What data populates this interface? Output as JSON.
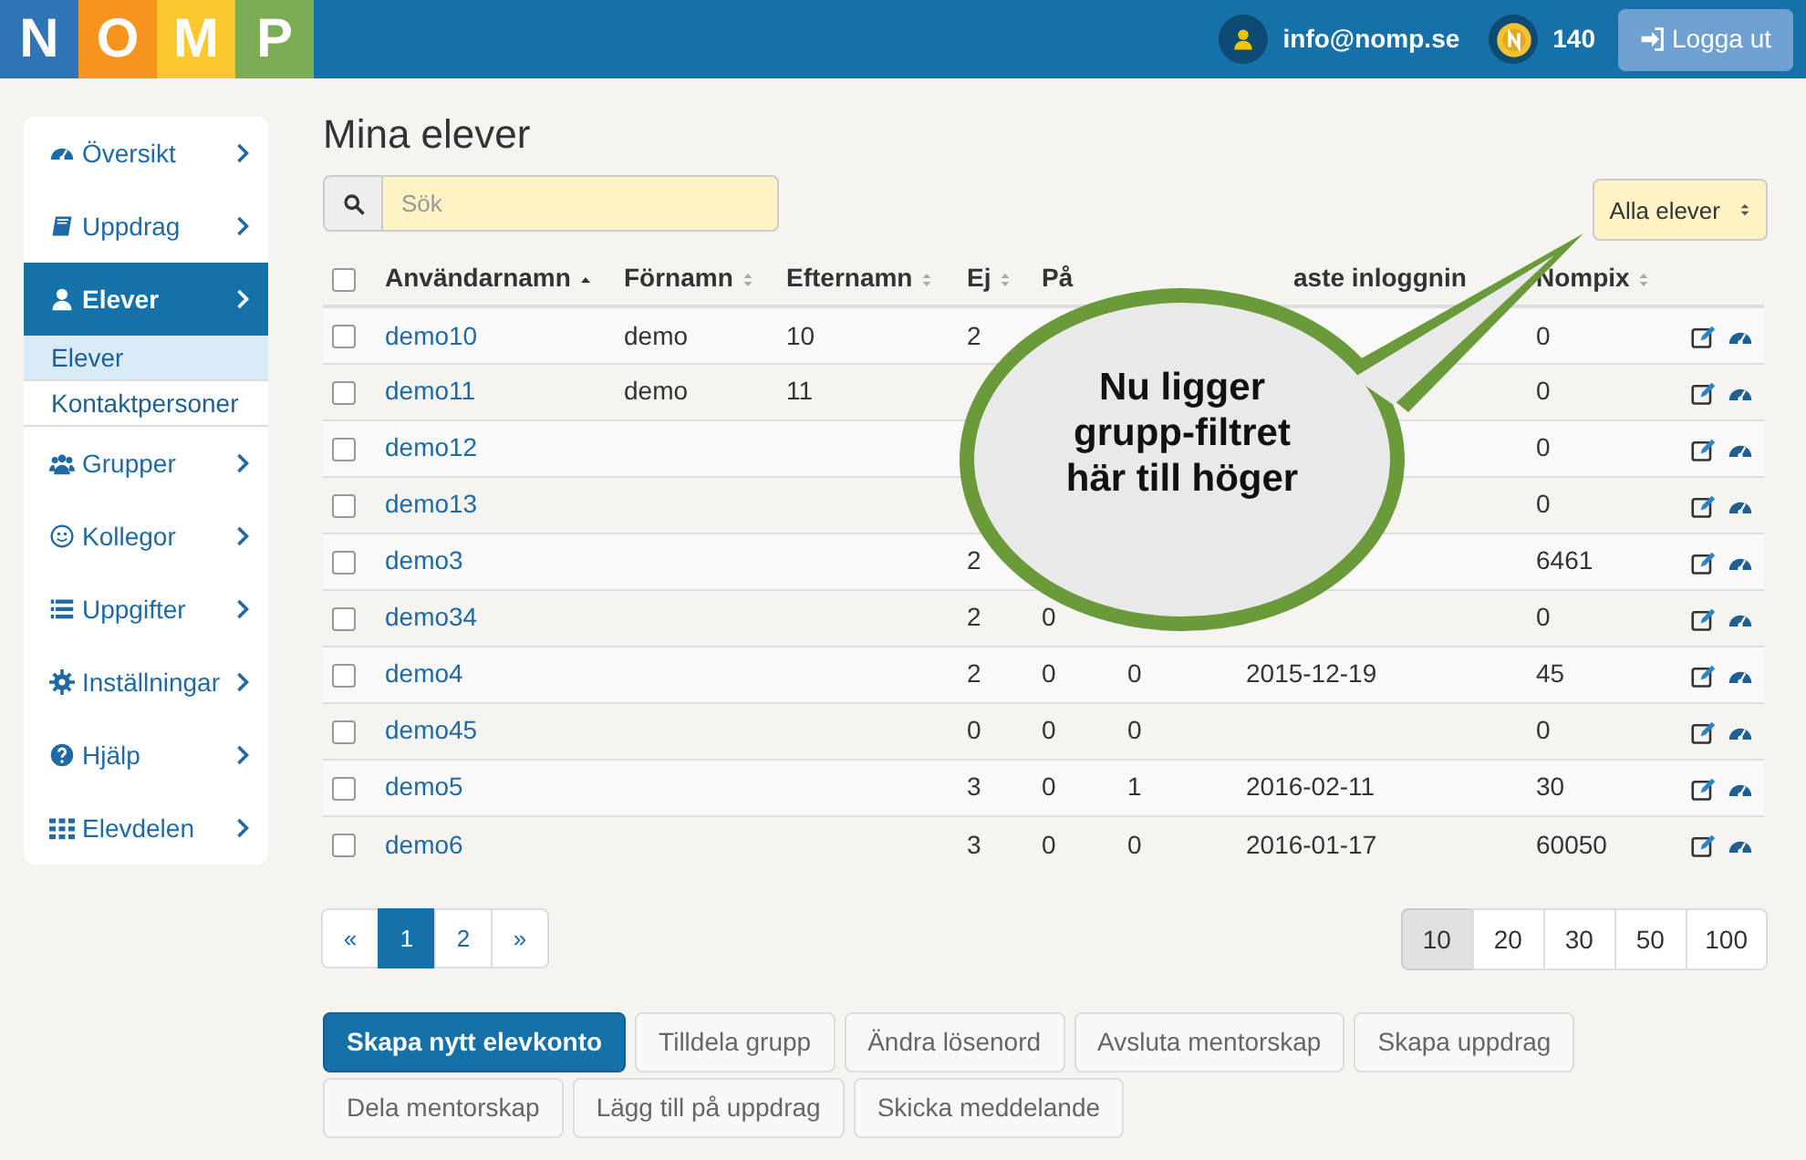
{
  "header": {
    "logo": [
      "N",
      "O",
      "M",
      "P"
    ],
    "user": "info@nomp.se",
    "coins": "140",
    "logout": "Logga ut"
  },
  "sidebar": {
    "items": [
      {
        "label": "Översikt",
        "selected": false
      },
      {
        "label": "Uppdrag",
        "selected": false
      },
      {
        "label": "Elever",
        "selected": true,
        "children": [
          {
            "label": "Elever",
            "selected": true
          },
          {
            "label": "Kontaktpersoner",
            "selected": false
          }
        ]
      },
      {
        "label": "Grupper",
        "selected": false
      },
      {
        "label": "Kollegor",
        "selected": false
      },
      {
        "label": "Uppgifter",
        "selected": false
      },
      {
        "label": "Inställningar",
        "selected": false
      },
      {
        "label": "Hjälp",
        "selected": false
      },
      {
        "label": "Elevdelen",
        "selected": false
      }
    ]
  },
  "title": "Mina elever",
  "search": {
    "placeholder": "Sök"
  },
  "filter": {
    "value": "Alla elever"
  },
  "table": {
    "select_all": {
      "checked": false
    },
    "columns": [
      {
        "label": "Användarnamn",
        "sortable": true,
        "sorted": true
      },
      {
        "label": "Förnamn",
        "sortable": true,
        "sorted": false
      },
      {
        "label": "Efternamn",
        "sortable": true,
        "sorted": false
      },
      {
        "label": "Ej",
        "sortable": true,
        "sorted": false
      },
      {
        "label": "På"
      },
      {},
      {
        "label": "aste inloggnin"
      },
      {
        "label": "Nompix",
        "sortable": true,
        "sorted": false
      }
    ],
    "rows": [
      {
        "checked": false,
        "cells": [
          "demo10",
          "demo",
          "10",
          "2",
          "",
          "",
          "",
          "0"
        ]
      },
      {
        "checked": false,
        "cells": [
          "demo11",
          "demo",
          "11",
          "",
          "",
          "",
          "",
          "0"
        ]
      },
      {
        "checked": false,
        "cells": [
          "demo12",
          "",
          "",
          "",
          "",
          "",
          "",
          "0"
        ]
      },
      {
        "checked": false,
        "cells": [
          "demo13",
          "",
          "",
          "",
          "",
          "",
          "",
          "0"
        ]
      },
      {
        "checked": false,
        "cells": [
          "demo3",
          "",
          "",
          "2",
          "",
          "",
          "",
          "6461"
        ]
      },
      {
        "checked": false,
        "cells": [
          "demo34",
          "",
          "",
          "2",
          "0",
          "",
          "",
          "0"
        ]
      },
      {
        "checked": false,
        "cells": [
          "demo4",
          "",
          "",
          "2",
          "0",
          "0",
          "2015-12-19",
          "45"
        ]
      },
      {
        "checked": false,
        "cells": [
          "demo45",
          "",
          "",
          "0",
          "0",
          "0",
          "",
          "0"
        ]
      },
      {
        "checked": false,
        "cells": [
          "demo5",
          "",
          "",
          "3",
          "0",
          "1",
          "2016-02-11",
          "30"
        ]
      },
      {
        "checked": false,
        "cells": [
          "demo6",
          "",
          "",
          "3",
          "0",
          "0",
          "2016-01-17",
          "60050"
        ]
      }
    ]
  },
  "callout": "Nu ligger grupp-filtret här till höger",
  "pagination": [
    {
      "label": "«",
      "selected": false
    },
    {
      "label": "1",
      "selected": true
    },
    {
      "label": "2",
      "selected": false
    },
    {
      "label": "»",
      "selected": false
    }
  ],
  "page_sizes": [
    {
      "label": "10",
      "selected": true
    },
    {
      "label": "20",
      "selected": false
    },
    {
      "label": "30",
      "selected": false
    },
    {
      "label": "50",
      "selected": false
    },
    {
      "label": "100",
      "selected": false
    }
  ],
  "actions": [
    {
      "label": "Skapa nytt elevkonto",
      "kind": "primary"
    },
    {
      "label": "Tilldela grupp",
      "kind": "default"
    },
    {
      "label": "Ändra lösenord",
      "kind": "default"
    },
    {
      "label": "Avsluta mentorskap",
      "kind": "default"
    },
    {
      "label": "Skapa uppdrag",
      "kind": "default"
    },
    {
      "label": "Dela mentorskap",
      "kind": "default"
    },
    {
      "label": "Lägg till på uppdrag",
      "kind": "default"
    },
    {
      "label": "Skicka meddelande",
      "kind": "default"
    }
  ]
}
